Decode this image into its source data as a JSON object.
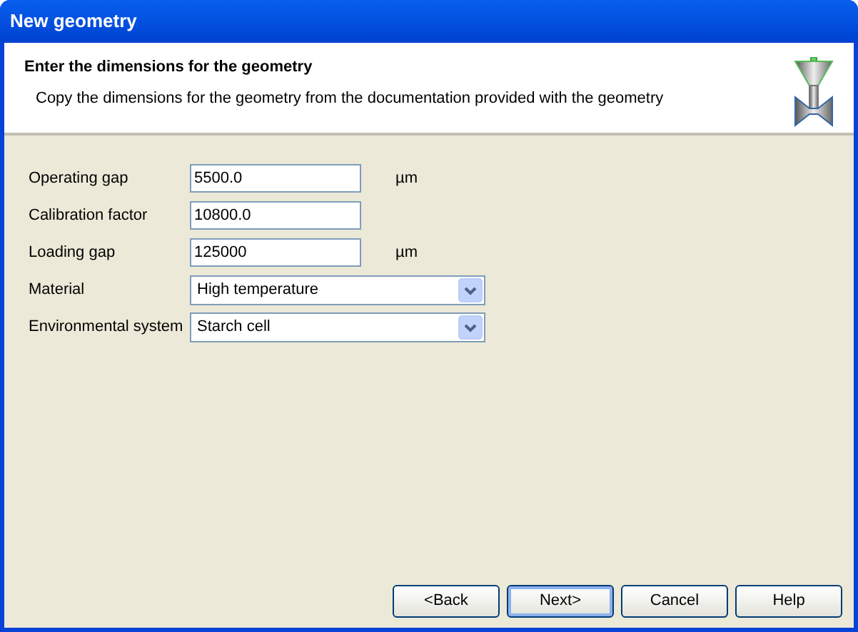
{
  "window": {
    "title": "New geometry"
  },
  "header": {
    "title": "Enter the dimensions for the geometry",
    "description": "Copy the dimensions for the geometry from the documentation provided with the geometry"
  },
  "fields": [
    {
      "kind": "text",
      "label": "Operating gap",
      "value": "5500.0",
      "unit": "µm"
    },
    {
      "kind": "text",
      "label": "Calibration factor",
      "value": "10800.0"
    },
    {
      "kind": "text",
      "label": "Loading gap",
      "value": "125000",
      "unit": "µm"
    },
    {
      "kind": "select",
      "label": "Material",
      "value": "High temperature"
    },
    {
      "kind": "select",
      "label": "Environmental system",
      "value": "Starch cell"
    }
  ],
  "buttons": [
    {
      "label": "<Back",
      "default": false
    },
    {
      "label": "Next>",
      "default": true
    },
    {
      "label": "Cancel",
      "default": false
    },
    {
      "label": "Help",
      "default": false
    }
  ]
}
